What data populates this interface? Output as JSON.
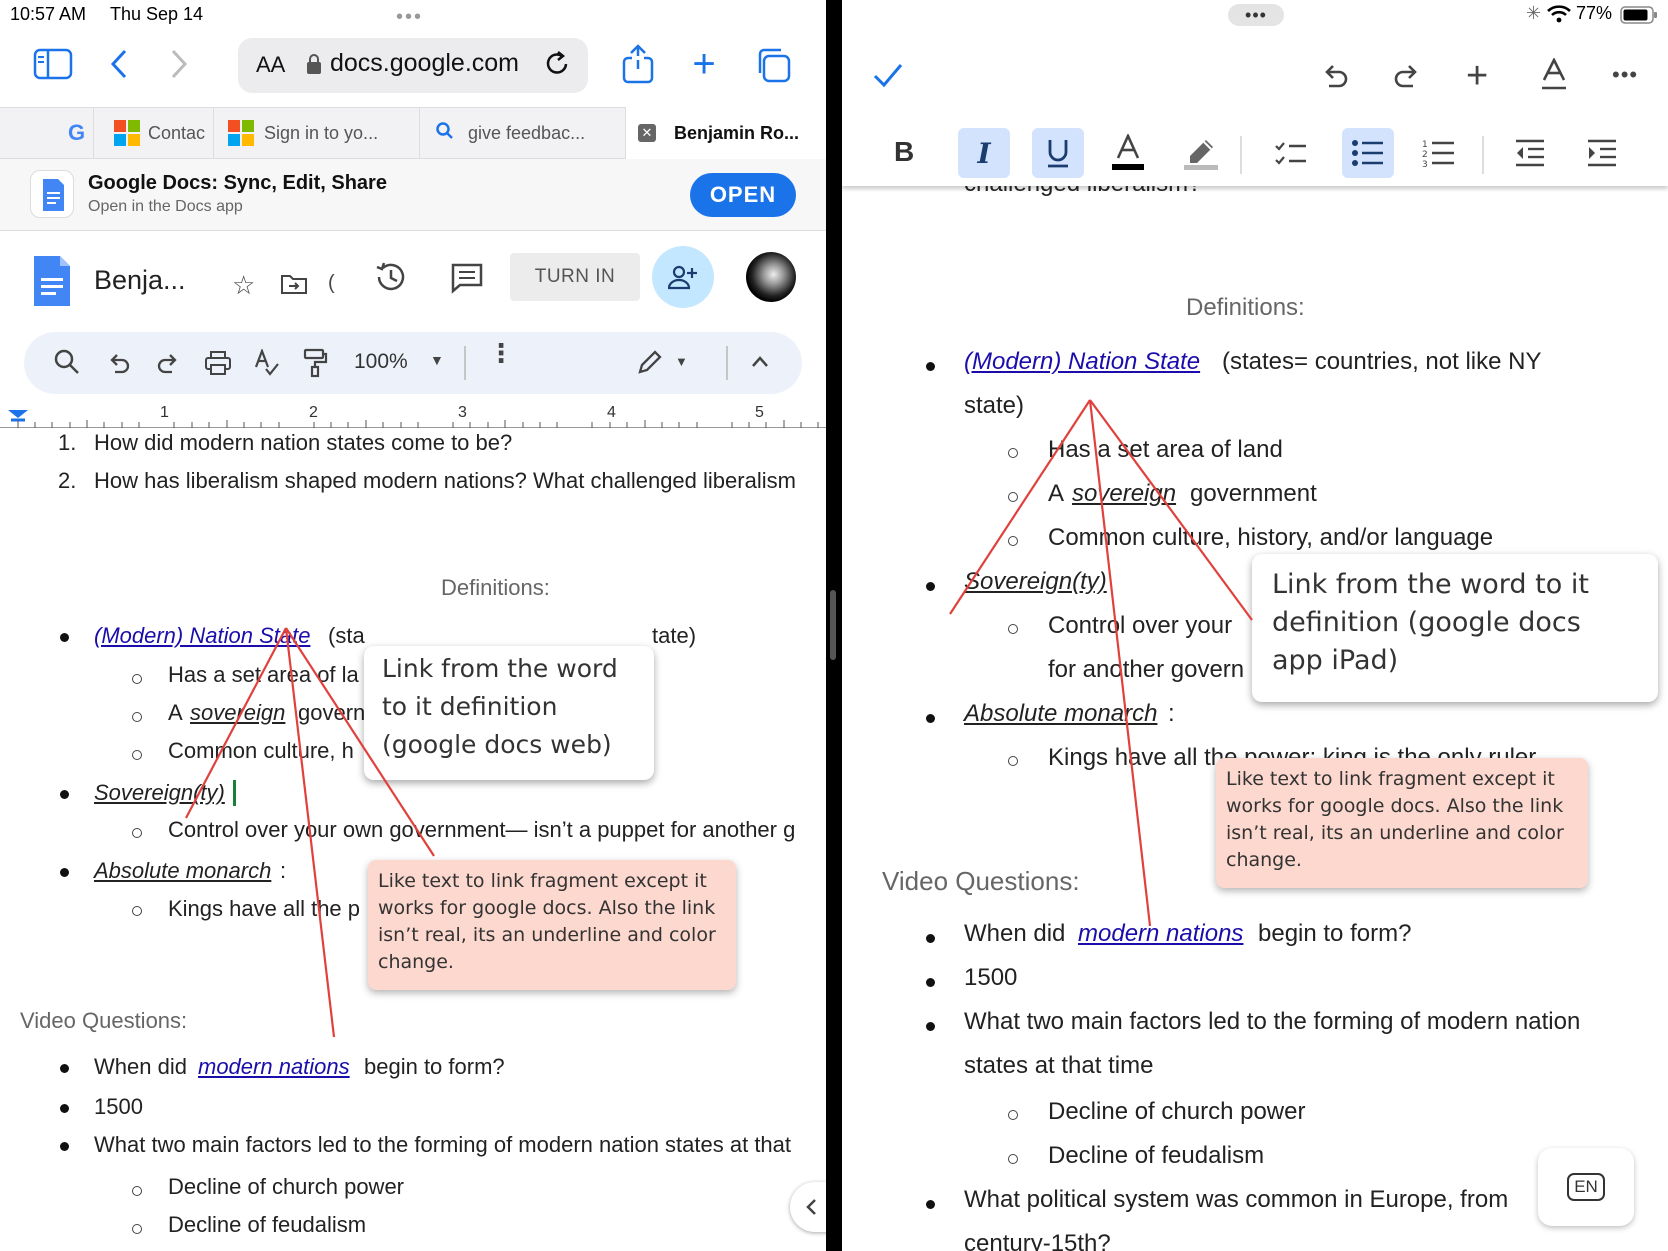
{
  "status": {
    "time": "10:57 AM",
    "date": "Thu Sep 14",
    "battery": "77%"
  },
  "safari": {
    "aa": "AA",
    "url": "docs.google.com"
  },
  "tabs": [
    {
      "label": "Contac",
      "icon": "microsoft-icon"
    },
    {
      "label": "Sign in to yo...",
      "icon": "microsoft-icon"
    },
    {
      "label": "give feedbac...",
      "icon": "search-icon"
    },
    {
      "label": "Benjamin Ro...",
      "icon": "close-icon"
    }
  ],
  "banner": {
    "title": "Google Docs: Sync, Edit, Share",
    "subtitle": "Open in the Docs app",
    "open": "OPEN"
  },
  "docs_header": {
    "doc_title": "Benja...",
    "turn_in": "TURN IN",
    "zoom": "100%"
  },
  "ruler": {
    "marks": [
      "1",
      "2",
      "3",
      "4",
      "5"
    ]
  },
  "left_doc": {
    "q1": "How did modern nation states come to be?",
    "q2": "How has liberalism shaped modern nations? What challenged liberalism",
    "q1_num": "1.",
    "q2_num": "2.",
    "definitions": "Definitions:",
    "nation_state": "(Modern) Nation State",
    "nation_state_rest": "(sta",
    "nation_state_tail": "tate)",
    "sub1": "Has a set area of la",
    "sub2_pre": "A",
    "sub2_link": "sovereign",
    "sub2_post": "govern",
    "sub3": "Common culture, h",
    "sovereignty": "Sovereign(ty)",
    "sov_sub": "Control over your own government— isn’t a puppet for another g",
    "absolute": "Absolute monarch",
    "absolute_colon": ":",
    "abs_sub": "Kings have all the p",
    "video": "Video Questions:",
    "vq1_pre": "When did",
    "vq1_link": "modern nations",
    "vq1_post": "begin to form?",
    "vq2": "1500",
    "vq3": "What two main factors led to the forming of modern nation states at that",
    "vq3a": "Decline of church power",
    "vq3b": "Decline of feudalism"
  },
  "left_callout": "Link from the word to it definition (google docs web)",
  "left_note": "Like text to link fragment except it works for google docs. Also the link isn’t real, its an underline and color change.",
  "right_doc": {
    "top_cut": "challenged liberalism?",
    "definitions": "Definitions:",
    "nation_state": "(Modern) Nation State",
    "nation_state_rest": "(states= countries, not like NY",
    "nation_state_cont": "state)",
    "sub1": "Has a set area of land",
    "sub2_pre": "A",
    "sub2_link": "sovereign",
    "sub2_post": "government",
    "sub3": "Common culture, history, and/or language",
    "sovereignty": "Sovereign(ty)",
    "sov_sub": "Control over your",
    "sov_sub2": "for another govern",
    "absolute": "Absolute monarch",
    "absolute_colon": ":",
    "abs_sub": "Kings have all the power; king is the only ruler",
    "video": "Video Questions:",
    "vq1_pre": "When did",
    "vq1_link": "modern nations",
    "vq1_post": "begin to form?",
    "vq2": "1500",
    "vq3": "What two main factors led to the forming of modern nation",
    "vq3_cont": "states at that time",
    "vq3a": "Decline of church power",
    "vq3b": "Decline of feudalism",
    "vq4": "What political system was common in Europe, from",
    "vq4_cont": "century-15th?"
  },
  "right_callout": "Link from the word to it definition (google docs app iPad)",
  "right_note": "Like text to link fragment except it works for google docs. Also the link isn’t real, its an underline and color change.",
  "keyboard": {
    "lang": "EN"
  },
  "colors": {
    "accent": "#1a73e8",
    "link": "#1a0dab",
    "note": "#fcd8cf",
    "arrow": "#e0413c"
  }
}
